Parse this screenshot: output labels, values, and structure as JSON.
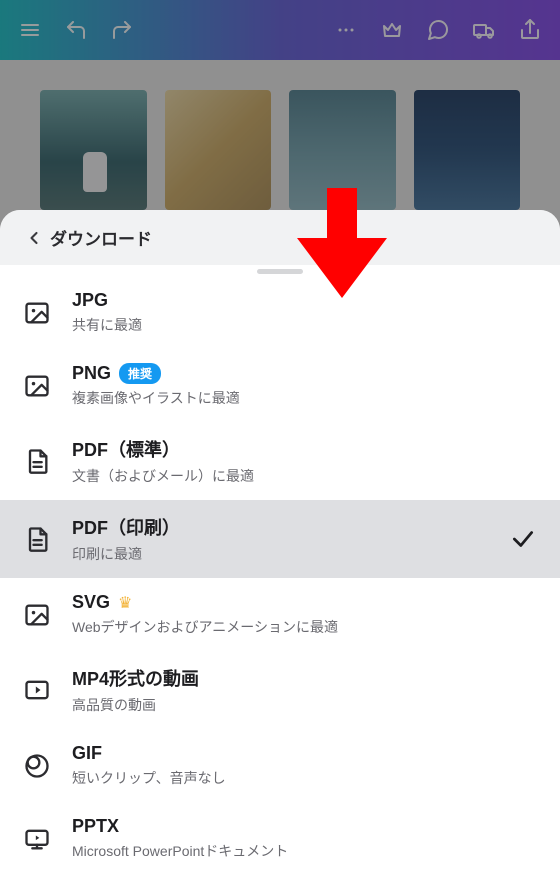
{
  "sheet": {
    "title": "ダウンロード"
  },
  "options": [
    {
      "title": "JPG",
      "desc": "共有に最適",
      "icon": "image",
      "selected": false
    },
    {
      "title": "PNG",
      "desc": "複素画像やイラストに最適",
      "icon": "image",
      "badge": "推奨",
      "selected": false
    },
    {
      "title": "PDF（標準）",
      "desc": "文書（およびメール）に最適",
      "icon": "doc",
      "selected": false
    },
    {
      "title": "PDF（印刷）",
      "desc": "印刷に最適",
      "icon": "doc",
      "selected": true
    },
    {
      "title": "SVG",
      "desc": "Webデザインおよびアニメーションに最適",
      "icon": "image",
      "crown": true,
      "selected": false
    },
    {
      "title": "MP4形式の動画",
      "desc": "高品質の動画",
      "icon": "video",
      "selected": false
    },
    {
      "title": "GIF",
      "desc": "短いクリップ、音声なし",
      "icon": "gif",
      "selected": false
    },
    {
      "title": "PPTX",
      "desc": "Microsoft PowerPointドキュメント",
      "icon": "pptx",
      "selected": false
    }
  ]
}
